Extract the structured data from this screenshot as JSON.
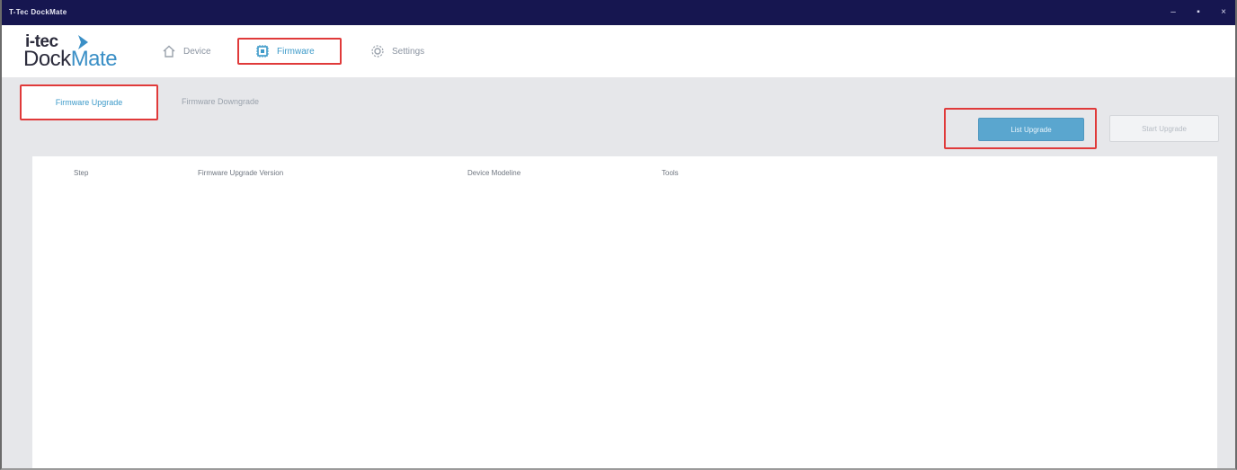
{
  "window": {
    "title": "T-Tec DockMate",
    "controls": [
      "–",
      "▪",
      "×"
    ]
  },
  "logo": {
    "line1": "i-tec",
    "line2_part1": "Dock",
    "line2_part2": "Mate"
  },
  "nav": {
    "device": "Device",
    "firmware": "Firmware",
    "settings": "Settings",
    "active": "firmware"
  },
  "tabs": {
    "update": "Firmware Upgrade",
    "downgrade": "Firmware Downgrade",
    "active": "update"
  },
  "actions": {
    "primary": "List Upgrade",
    "secondary": "Start Upgrade"
  },
  "table": {
    "columns": [
      "Step",
      "Firmware Upgrade Version",
      "Device Modeline",
      "Tools"
    ],
    "rows": []
  },
  "colors": {
    "titlebar": "#161650",
    "accent": "#3d9ac9",
    "highlight": "#e03a3a"
  }
}
